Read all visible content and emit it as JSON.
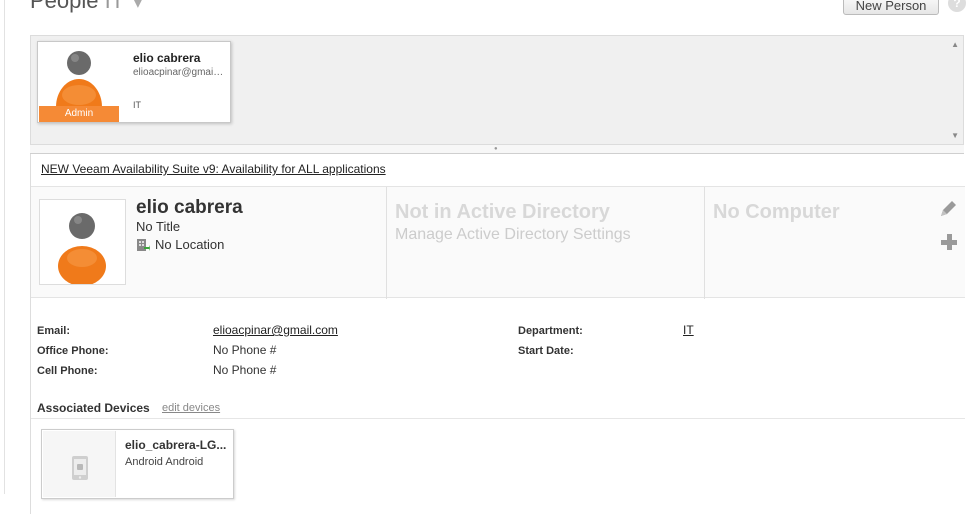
{
  "header": {
    "title": "People",
    "subtitle": "IT",
    "new_person_label": "New Person",
    "help_glyph": "?"
  },
  "people_list": {
    "cards": [
      {
        "name": "elio cabrera",
        "email": "elioacpinar@gmail.com",
        "department": "IT",
        "role_badge": "Admin",
        "avatar_icon": "user-avatar-icon"
      }
    ],
    "scroll_up_glyph": "▲",
    "scroll_down_glyph": "▼"
  },
  "detail": {
    "banner_link": "NEW Veeam Availability Suite v9: Availability for ALL applications",
    "name": "elio cabrera",
    "title": "No Title",
    "location": "No Location",
    "ad_status": "Not in Active Directory",
    "ad_link": "Manage Active Directory Settings",
    "computer_status": "No Computer",
    "fields": {
      "email_label": "Email:",
      "email_value": "elioacpinar@gmail.com",
      "office_phone_label": "Office Phone:",
      "office_phone_value": "No Phone #",
      "cell_phone_label": "Cell Phone:",
      "cell_phone_value": "No Phone #",
      "department_label": "Department:",
      "department_value": "IT",
      "start_date_label": "Start Date:",
      "start_date_value": ""
    },
    "associated_devices": {
      "title": "Associated Devices",
      "edit_label": "edit devices",
      "devices": [
        {
          "name": "elio_cabrera-LG...",
          "os": "Android Android",
          "icon": "android-device-icon"
        }
      ]
    }
  },
  "colors": {
    "accent_orange": "#f58a36",
    "avatar_body": "#f07a1a",
    "avatar_head": "#6a6a6a",
    "muted_text": "#d8d8d8"
  }
}
